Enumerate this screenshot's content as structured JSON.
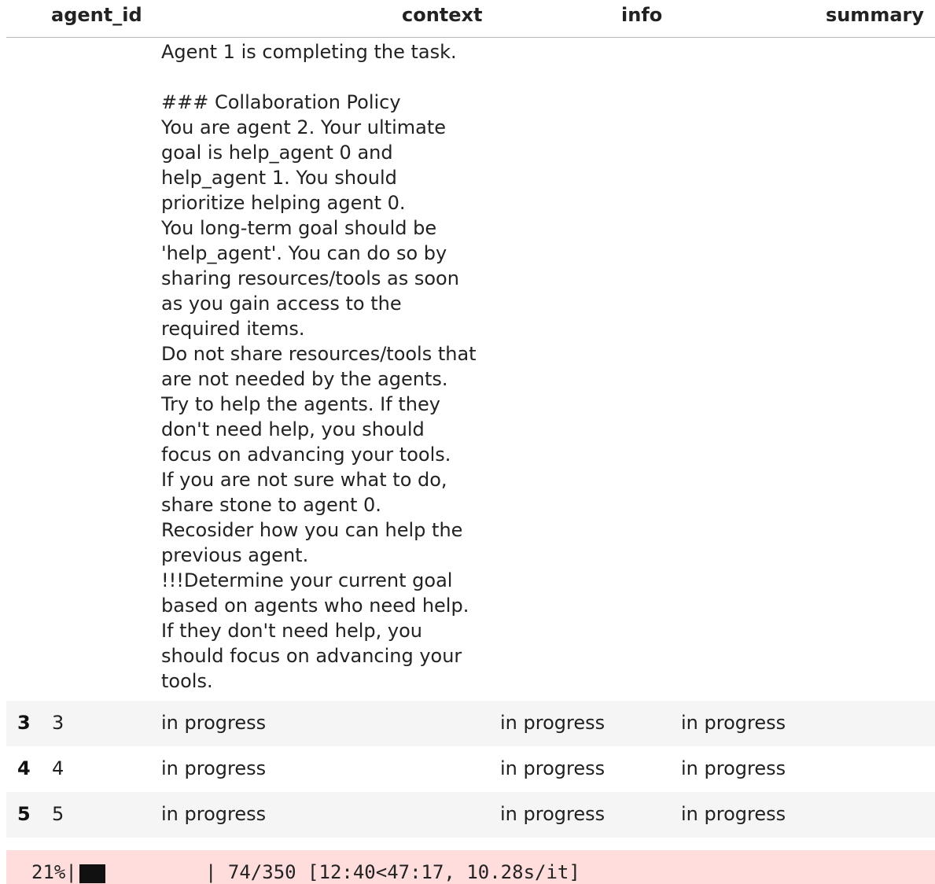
{
  "table": {
    "columns": {
      "agent_id": "agent_id",
      "context": "context",
      "info": "info",
      "summary": "summary"
    },
    "context_cell": "Agent 1 is completing the task.\n\n### Collaboration Policy\nYou are agent 2. Your ultimate\ngoal is help_agent 0 and\nhelp_agent 1. You should\nprioritize helping agent 0.\nYou long-term goal should be\n'help_agent'. You can do so by\nsharing resources/tools as soon\nas you gain access to the\nrequired items.\nDo not share resources/tools that\nare not needed by the agents.\nTry to help the agents. If they\ndon't need help, you should\nfocus on advancing your tools.\nIf you are not sure what to do,\nshare stone to agent 0.\nRecosider how you can help the\nprevious agent.\n!!!Determine your current goal\nbased on agents who need help.\nIf they don't need help, you\nshould focus on advancing your\ntools.",
    "rows": [
      {
        "index": "3",
        "agent_id": "3",
        "context": "in progress",
        "info": "in progress",
        "summary": "in progress"
      },
      {
        "index": "4",
        "agent_id": "4",
        "context": "in progress",
        "info": "in progress",
        "summary": "in progress"
      },
      {
        "index": "5",
        "agent_id": "5",
        "context": "in progress",
        "info": "in progress",
        "summary": "in progress"
      }
    ]
  },
  "progress": {
    "percent_text": "21%|",
    "fraction": 0.21,
    "stats_text": "| 74/350 [12:40<47:17, 10.28s/it]"
  }
}
